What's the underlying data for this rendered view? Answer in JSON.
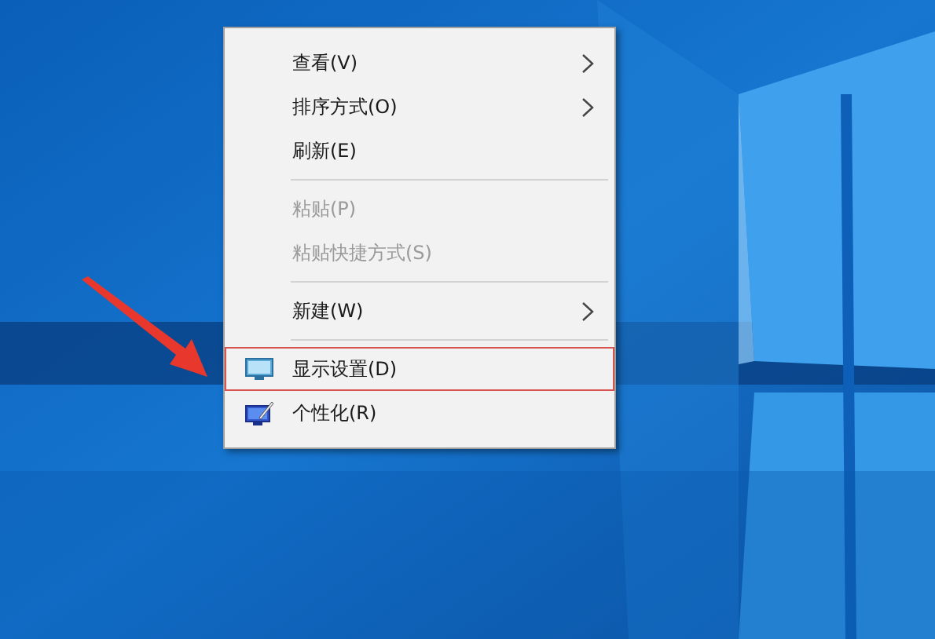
{
  "context_menu": {
    "items": [
      {
        "kind": "item",
        "text": "查看(V)",
        "disabled": false,
        "submenu": true,
        "highlighted": false
      },
      {
        "kind": "item",
        "text": "排序方式(O)",
        "disabled": false,
        "submenu": true,
        "highlighted": false
      },
      {
        "kind": "item",
        "text": "刷新(E)",
        "disabled": false,
        "submenu": false,
        "highlighted": false
      },
      {
        "kind": "separator"
      },
      {
        "kind": "item",
        "text": "粘贴(P)",
        "disabled": true,
        "submenu": false,
        "highlighted": false
      },
      {
        "kind": "item",
        "text": "粘贴快捷方式(S)",
        "disabled": true,
        "submenu": false,
        "highlighted": false
      },
      {
        "kind": "separator"
      },
      {
        "kind": "item",
        "text": "新建(W)",
        "disabled": false,
        "submenu": true,
        "highlighted": false
      },
      {
        "kind": "separator"
      },
      {
        "kind": "monitor",
        "text": "显示设置(D)",
        "disabled": false,
        "submenu": false,
        "highlighted": true
      },
      {
        "kind": "brush",
        "text": "个性化(R)",
        "disabled": false,
        "submenu": false,
        "highlighted": false
      }
    ]
  }
}
